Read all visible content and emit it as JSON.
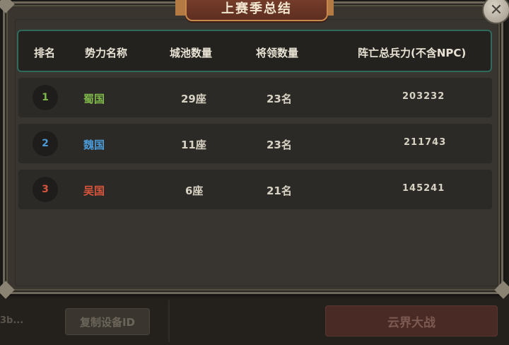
{
  "dialog": {
    "title": "上赛季总结",
    "close_label": "✕"
  },
  "header": {
    "rank": "排名",
    "faction": "势力名称",
    "cities": "城池数量",
    "generals": "将领数量",
    "casualties": "阵亡总兵力(不含NPC)"
  },
  "rows": [
    {
      "rank": "1",
      "faction": "蜀国",
      "cities": "29座",
      "generals": "23名",
      "casualties": "203232",
      "color": "#7fb84a"
    },
    {
      "rank": "2",
      "faction": "魏国",
      "cities": "11座",
      "generals": "23名",
      "casualties": "211743",
      "color": "#4b9ad8"
    },
    {
      "rank": "3",
      "faction": "吴国",
      "cities": "6座",
      "generals": "21名",
      "casualties": "145241",
      "color": "#d8553d"
    }
  ],
  "background": {
    "left_text": "3b...",
    "copy_device_id": "复制设备ID",
    "battle_button": "云界大战"
  }
}
